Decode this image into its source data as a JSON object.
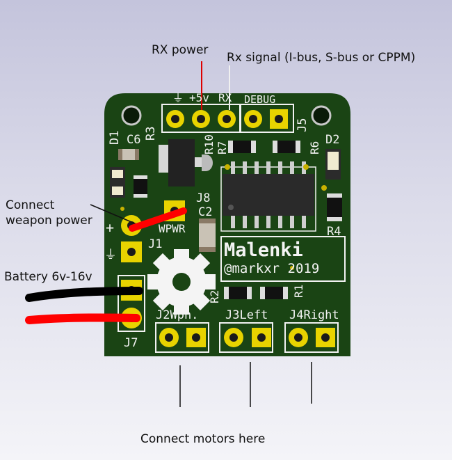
{
  "annotations": {
    "rx_power": "RX power",
    "rx_signal": "Rx signal (I-bus, S-bus or CPPM)",
    "connect_weapon_power": "Connect\nweapon power",
    "battery": "Battery 6v-16v",
    "connect_motors": "Connect motors here"
  },
  "silkscreen": {
    "gnd_symbol": "⏚",
    "plus5v": "+5v",
    "rx": "RX",
    "debug": "DEBUG",
    "j5": "J5",
    "r3": "R3",
    "c6": "C6",
    "d1": "D1",
    "r10": "R10",
    "r7": "R7",
    "r6": "R6",
    "d2": "D2",
    "j8": "J8",
    "c2": "C2",
    "wpwr": "WPWR",
    "plus": "+",
    "j1": "J1",
    "j7": "J7",
    "r4": "R4",
    "brand": "Malenki",
    "author_year": "@markxr 2019",
    "r2": "R2",
    "r1": "R1",
    "j2": "J2Wpn.",
    "j3": "J3Left",
    "j4": "J4Right"
  },
  "colors": {
    "pcb": "#1a4414",
    "silk": "#f2f2f2",
    "pad": "#e8d300",
    "wire_red": "#ff0000",
    "wire_black": "#000000"
  }
}
